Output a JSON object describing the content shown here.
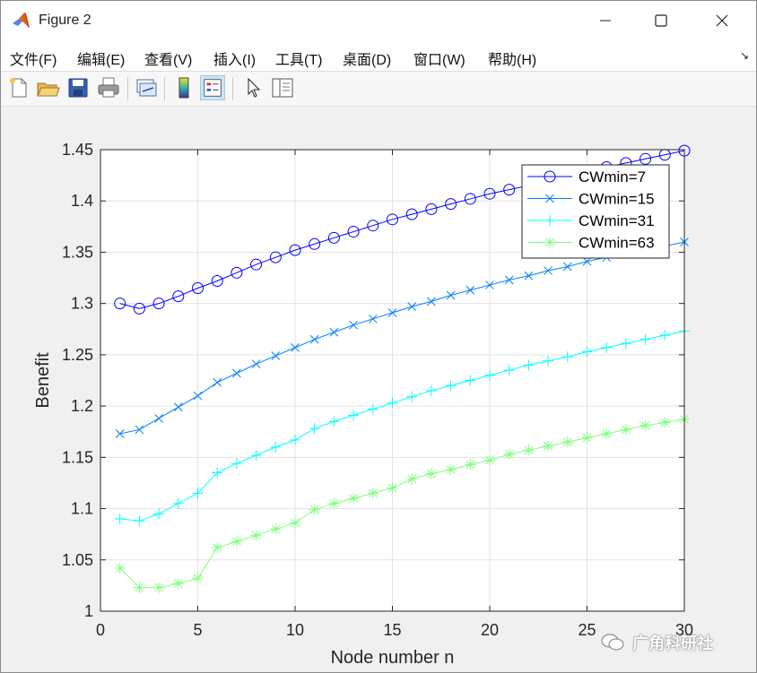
{
  "window": {
    "title": "Figure 2",
    "controls": {
      "minimize": "minimize",
      "maximize": "maximize",
      "close": "close"
    }
  },
  "menu": {
    "items": [
      "文件(F)",
      "编辑(E)",
      "查看(V)",
      "插入(I)",
      "工具(T)",
      "桌面(D)",
      "窗口(W)",
      "帮助(H)"
    ],
    "corner_glyph": "↘"
  },
  "toolbar": {
    "buttons": [
      {
        "icon": "new-figure-icon"
      },
      {
        "icon": "open-file-icon"
      },
      {
        "icon": "save-icon"
      },
      {
        "icon": "print-icon"
      },
      {
        "icon": "link-plot-icon"
      },
      {
        "icon": "colorbar-icon"
      },
      {
        "icon": "legend-icon",
        "active": true
      },
      {
        "icon": "pointer-icon"
      },
      {
        "icon": "property-editor-icon"
      }
    ]
  },
  "colors": {
    "CWmin=7": "#0000ff",
    "CWmin=15": "#0080ff",
    "CWmin=31": "#00ffff",
    "CWmin=63": "#80ff80",
    "grid": "#e3e3e3",
    "axes_bg": "#ffffff"
  },
  "chart_data": {
    "type": "line",
    "xlabel": "Node number n",
    "ylabel": "Benefit",
    "xlim": [
      0,
      30
    ],
    "ylim": [
      1,
      1.45
    ],
    "xticks": [
      0,
      5,
      10,
      15,
      20,
      25,
      30
    ],
    "yticks": [
      1,
      1.05,
      1.1,
      1.15,
      1.2,
      1.25,
      1.3,
      1.35,
      1.4,
      1.45
    ],
    "ytick_labels": [
      "1",
      "1.05",
      "1.1",
      "1.15",
      "1.2",
      "1.25",
      "1.3",
      "1.35",
      "1.4",
      "1.45"
    ],
    "grid": true,
    "legend_position": "top-right",
    "x": [
      1,
      2,
      3,
      4,
      5,
      6,
      7,
      8,
      9,
      10,
      11,
      12,
      13,
      14,
      15,
      16,
      17,
      18,
      19,
      20,
      21,
      22,
      23,
      24,
      25,
      26,
      27,
      28,
      29,
      30
    ],
    "series": [
      {
        "name": "CWmin=7",
        "marker": "circle",
        "values": [
          1.3,
          1.295,
          1.3,
          1.307,
          1.315,
          1.322,
          1.33,
          1.338,
          1.345,
          1.352,
          1.358,
          1.364,
          1.37,
          1.376,
          1.382,
          1.387,
          1.392,
          1.397,
          1.402,
          1.407,
          1.411,
          1.415,
          1.419,
          1.423,
          1.428,
          1.433,
          1.437,
          1.441,
          1.445,
          1.449
        ]
      },
      {
        "name": "CWmin=15",
        "marker": "x",
        "values": [
          1.173,
          1.177,
          1.188,
          1.199,
          1.21,
          1.223,
          1.232,
          1.241,
          1.249,
          1.257,
          1.265,
          1.272,
          1.279,
          1.285,
          1.291,
          1.297,
          1.302,
          1.308,
          1.313,
          1.318,
          1.323,
          1.327,
          1.332,
          1.336,
          1.341,
          1.345,
          1.349,
          1.352,
          1.356,
          1.36
        ]
      },
      {
        "name": "CWmin=31",
        "marker": "plus",
        "values": [
          1.09,
          1.088,
          1.095,
          1.105,
          1.115,
          1.135,
          1.144,
          1.152,
          1.16,
          1.167,
          1.178,
          1.185,
          1.191,
          1.197,
          1.203,
          1.209,
          1.215,
          1.22,
          1.225,
          1.23,
          1.235,
          1.24,
          1.244,
          1.248,
          1.253,
          1.257,
          1.261,
          1.265,
          1.269,
          1.273
        ]
      },
      {
        "name": "CWmin=63",
        "marker": "asterisk",
        "values": [
          1.042,
          1.023,
          1.023,
          1.027,
          1.032,
          1.062,
          1.068,
          1.074,
          1.08,
          1.086,
          1.099,
          1.105,
          1.11,
          1.115,
          1.12,
          1.129,
          1.134,
          1.138,
          1.143,
          1.147,
          1.153,
          1.157,
          1.161,
          1.165,
          1.169,
          1.173,
          1.177,
          1.181,
          1.184,
          1.187
        ]
      }
    ]
  },
  "watermark": {
    "text": "广角科研社"
  }
}
